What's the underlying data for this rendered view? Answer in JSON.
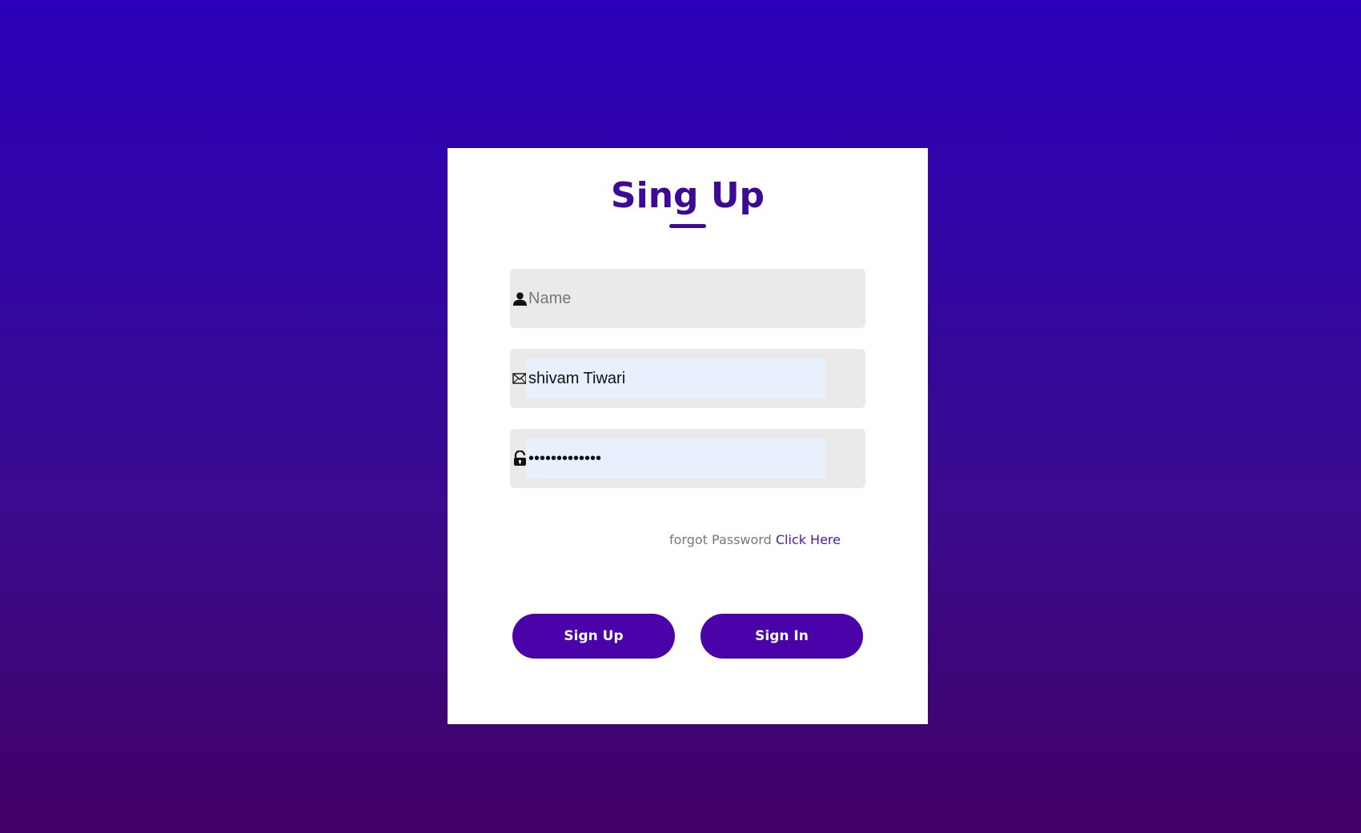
{
  "form": {
    "title": "Sing Up",
    "name_field": {
      "icon": "user-icon",
      "placeholder": "Name",
      "value": ""
    },
    "email_field": {
      "icon": "envelope-icon",
      "placeholder": "",
      "value": "shivam Tiwari"
    },
    "password_field": {
      "icon": "lock-icon",
      "placeholder": "",
      "value": "•••••••••••••"
    },
    "forgot_text": "forgot Password",
    "forgot_link": "Click Here",
    "signup_label": "Sign Up",
    "signin_label": "Sign In"
  },
  "colors": {
    "accent": "#4a03a8",
    "title": "#3c0a96",
    "background_top": "#2a00b8",
    "background_bottom": "#420066",
    "field_bg": "#eaeaea",
    "autofill_bg": "#e8f0fe"
  }
}
